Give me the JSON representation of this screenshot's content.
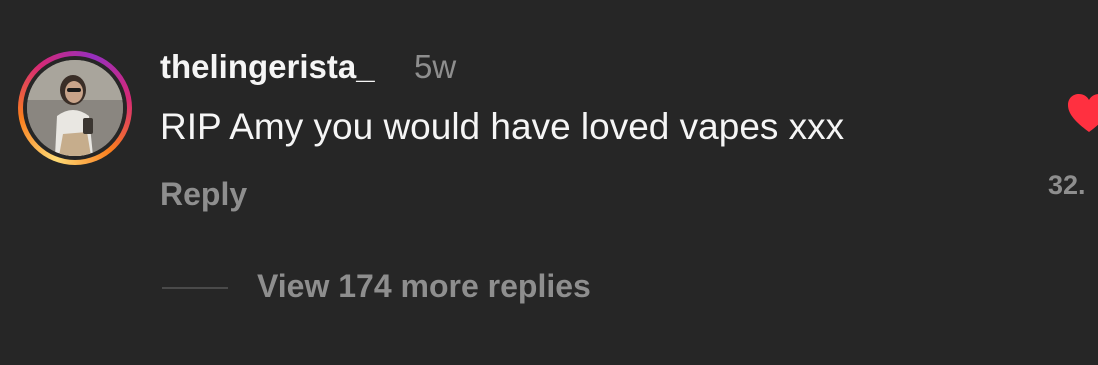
{
  "comment": {
    "username": "thelingerista_",
    "time": "5w",
    "text": "RIP Amy you would have loved vapes xxx",
    "reply_label": "Reply",
    "like_count": "32.",
    "like_icon": "heart-icon",
    "liked": true,
    "view_replies_label": "View 174 more replies"
  },
  "colors": {
    "background": "#262626",
    "primary_text": "#f5f5f5",
    "secondary_text": "#8e8e8e",
    "heart": "#ff3040"
  }
}
